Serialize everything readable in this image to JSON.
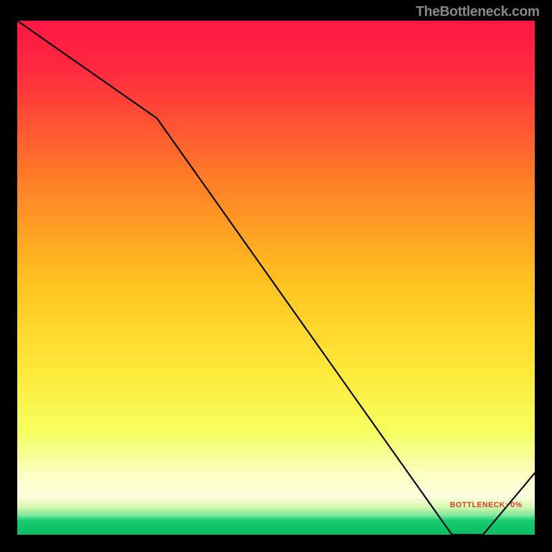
{
  "watermark": "TheBottleneck.com",
  "bottleneck_label": "BOTTLENECK: 0%",
  "colors": {
    "background": "#000000",
    "line": "#000000",
    "watermark": "#888888",
    "bottleneck_text": "#e02020",
    "gradient_top": "#ff1744",
    "gradient_mid1": "#ff5030",
    "gradient_mid2": "#ffa020",
    "gradient_mid3": "#ffe030",
    "gradient_mid4": "#f8ff50",
    "gradient_pale": "#fcfec0",
    "gradient_green": "#12cc70"
  },
  "chart_data": {
    "type": "line",
    "title": "",
    "xlabel": "",
    "ylabel": "",
    "xlim": [
      0,
      100
    ],
    "ylim": [
      0,
      100
    ],
    "x": [
      0,
      27,
      84,
      90,
      100
    ],
    "y": [
      100,
      81,
      0,
      0,
      12
    ],
    "bottleneck_zone_x": [
      84,
      90
    ],
    "notes": "Line descends from top-left, slope changes around x≈27, reaches y=0 around x≈84–90 (flat BOTTLENECK:0% zone), then rises to ≈12 at x=100. Background is a vertical red→orange→yellow→pale→green gradient with a thin bright green band at the very bottom."
  }
}
